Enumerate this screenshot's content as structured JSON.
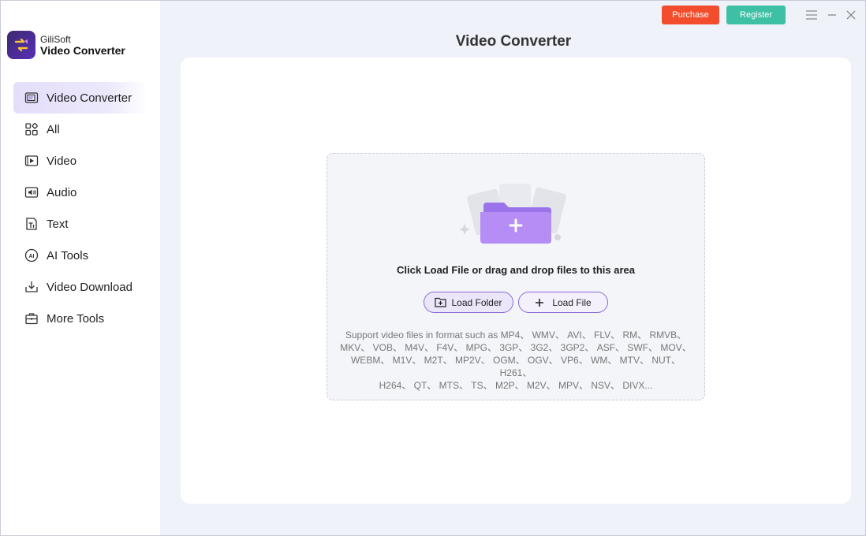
{
  "app": {
    "brand": "GiliSoft",
    "product": "Video Converter"
  },
  "topbar": {
    "purchase_label": "Purchase",
    "register_label": "Register"
  },
  "sidebar": {
    "items": [
      {
        "label": "Video Converter",
        "icon": "video-converter-icon"
      },
      {
        "label": "All",
        "icon": "grid-icon"
      },
      {
        "label": "Video",
        "icon": "video-play-icon"
      },
      {
        "label": "Audio",
        "icon": "audio-icon"
      },
      {
        "label": "Text",
        "icon": "text-icon"
      },
      {
        "label": "AI Tools",
        "icon": "ai-icon"
      },
      {
        "label": "Video Download",
        "icon": "download-icon"
      },
      {
        "label": "More Tools",
        "icon": "toolbox-icon"
      }
    ]
  },
  "main": {
    "title": "Video Converter",
    "hint": "Click Load File or drag and drop files to this area",
    "load_folder_label": "Load Folder",
    "load_file_label": "Load File",
    "formats_line1": "Support video files in format such as MP4、 WMV、 AVI、 FLV、 RM、 RMVB、",
    "formats_line2": "MKV、 VOB、 M4V、 F4V、 MPG、 3GP、 3G2、 3GP2、 ASF、 SWF、 MOV、",
    "formats_line3": "WEBM、 M1V、 M2T、 MP2V、 OGM、 OGV、 VP6、 WM、 MTV、 NUT、 H261、",
    "formats_line4": "H264、 QT、 MTS、 TS、 M2P、 M2V、 MPV、 NSV、 DIVX..."
  },
  "colors": {
    "accent": "#8a6ad6",
    "purchase": "#f24e2d",
    "register": "#3ec0a5"
  }
}
